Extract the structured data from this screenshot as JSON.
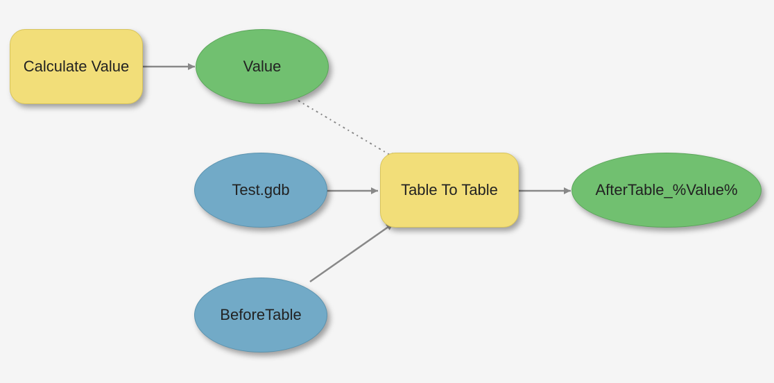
{
  "diagram": {
    "nodes": {
      "calculate_value": {
        "label": "Calculate Value",
        "kind": "tool"
      },
      "value": {
        "label": "Value",
        "kind": "derived"
      },
      "test_gdb": {
        "label": "Test.gdb",
        "kind": "data"
      },
      "before_table": {
        "label": "BeforeTable",
        "kind": "data"
      },
      "table_to_table": {
        "label": "Table To Table",
        "kind": "tool"
      },
      "after_table": {
        "label": "AfterTable_%Value%",
        "kind": "output"
      }
    },
    "edges": [
      {
        "from": "calculate_value",
        "to": "value",
        "style": "solid"
      },
      {
        "from": "value",
        "to": "table_to_table",
        "style": "dashed"
      },
      {
        "from": "test_gdb",
        "to": "table_to_table",
        "style": "solid"
      },
      {
        "from": "before_table",
        "to": "table_to_table",
        "style": "solid"
      },
      {
        "from": "table_to_table",
        "to": "after_table",
        "style": "solid"
      }
    ],
    "palette": {
      "tool": "#f2de79",
      "derived": "#71c070",
      "output": "#71c070",
      "data": "#72aac7",
      "arrow": "#888888"
    }
  }
}
